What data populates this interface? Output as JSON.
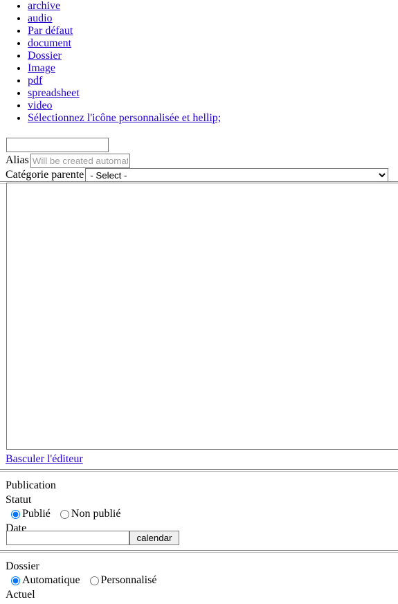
{
  "icon_list": {
    "items": [
      {
        "label": "archive"
      },
      {
        "label": "audio"
      },
      {
        "label": "Par défaut"
      },
      {
        "label": "document"
      },
      {
        "label": "Dossier"
      },
      {
        "label": "Image"
      },
      {
        "label": "pdf"
      },
      {
        "label": "spreadsheet"
      },
      {
        "label": "video"
      },
      {
        "label": "Sélectionnez l'icône personnalisée et hellip;"
      }
    ]
  },
  "form": {
    "name_field": {
      "value": "",
      "placeholder": ""
    },
    "alias": {
      "label": "Alias",
      "value": "",
      "placeholder": "Will be created automatically"
    },
    "parent_category": {
      "label": "Catégorie parente",
      "selected": "- Select -",
      "options": [
        "- Select -"
      ]
    },
    "description": {
      "value": ""
    },
    "toggle_editor_link": "Basculer l'éditeur"
  },
  "publication": {
    "legend": "Publication",
    "status": {
      "label": "Statut",
      "options": [
        {
          "label": "Publié",
          "checked": true
        },
        {
          "label": "Non publié",
          "checked": false
        }
      ]
    },
    "date": {
      "label": "Date",
      "value": "",
      "calendar_button": "calendar"
    }
  },
  "folder": {
    "legend": "Dossier",
    "mode": {
      "options": [
        {
          "label": "Automatique",
          "checked": true
        },
        {
          "label": "Personnalisé",
          "checked": false
        }
      ]
    },
    "current_label": "Actuel"
  },
  "colors": {
    "link": "#2200cc",
    "border": "#767676",
    "button_face": "#efefef",
    "placeholder": "#9a9a9a"
  }
}
